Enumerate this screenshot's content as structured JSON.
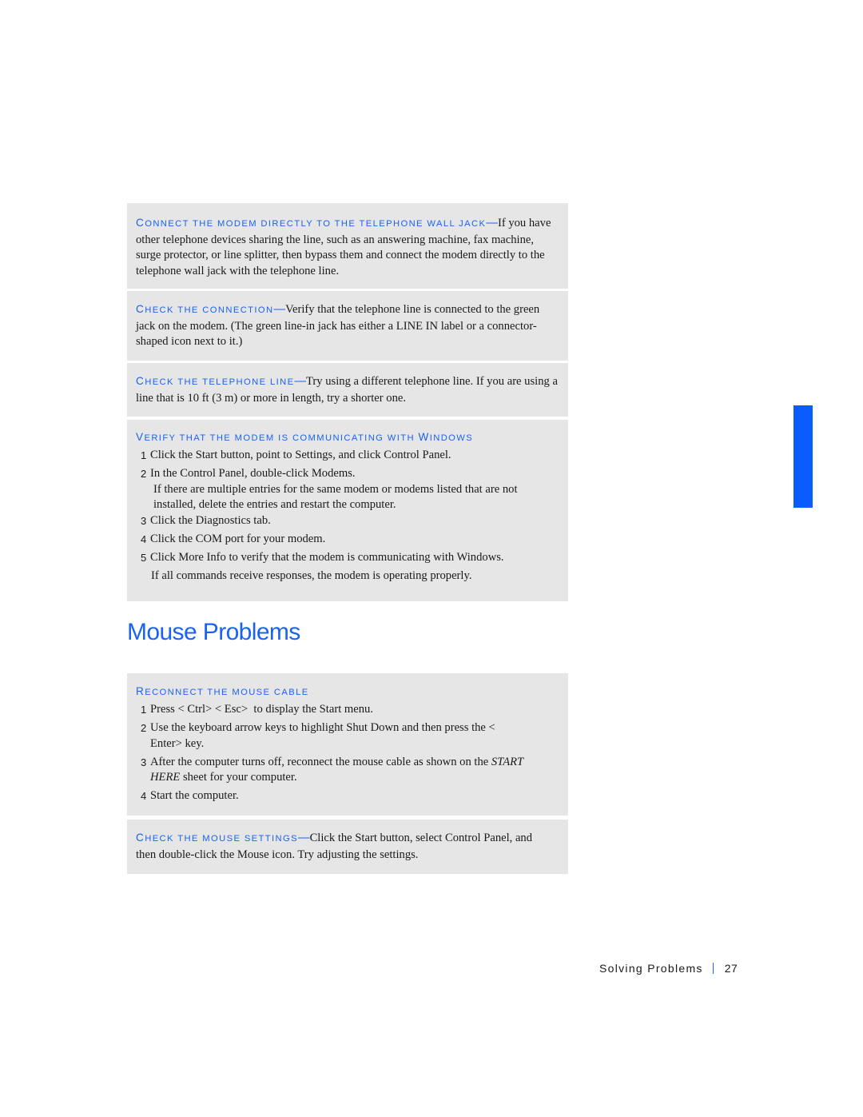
{
  "boxes": {
    "wall_jack": {
      "heading_cap": "C",
      "heading_rest": "onnect the modem directly to the telephone wall jack",
      "dash": "—",
      "body": "If you have other telephone devices sharing the line, such as an answering machine, fax machine, surge protector, or line splitter, then bypass them and connect the modem directly to the telephone wall jack with the telephone line."
    },
    "connection": {
      "heading_cap": "C",
      "heading_rest": "heck the connection",
      "dash": "—",
      "body": "Verify that the telephone line is connected to the green jack on the modem. (The green line-in jack has either a LINE IN label or a connector-shaped icon next to it.)"
    },
    "telephone_line": {
      "heading_cap": "C",
      "heading_rest": "heck the telephone line",
      "dash": "—",
      "body": "Try using a different telephone line. If you are using a line that is 10 ft (3 m) or more in length, try a shorter one."
    },
    "verify_modem": {
      "heading_cap": "V",
      "heading_rest": "erify that the modem is communicating with ",
      "heading_cap2": "W",
      "heading_rest2": "indows",
      "steps": [
        {
          "num": "1",
          "text": "Click the Start button, point to Settings, and click Control Panel."
        },
        {
          "num": "2",
          "text": "In the Control Panel, double-click Modems."
        },
        {
          "num": "3",
          "text": "Click the Diagnostics tab."
        },
        {
          "num": "4",
          "text": "Click the COM port for your modem."
        },
        {
          "num": "5",
          "text": "Click More Info to verify that the modem is communicating with Windows."
        }
      ],
      "step2_note": "If there are multiple entries for the same modem or modems listed that are not installed, delete the entries and restart the computer.",
      "followup": "If all commands receive responses, the modem is operating properly."
    },
    "reconnect_mouse": {
      "heading_cap": "R",
      "heading_rest": "econnect the mouse cable",
      "steps": [
        {
          "num": "1",
          "text": "Press < Ctrl> < Esc>  to display the Start menu."
        },
        {
          "num": "2",
          "text": "Use the keyboard arrow keys to highlight Shut Down and then press the < Enter>  key."
        },
        {
          "num": "3",
          "text_italic": "START HERE",
          "text_pre": "After the computer turns off, reconnect the mouse cable as shown on the ",
          "text_post": " sheet for your computer."
        },
        {
          "num": "4",
          "text": "Start the computer."
        }
      ]
    },
    "mouse_settings": {
      "heading_cap": "C",
      "heading_rest": "heck the mouse settings",
      "dash": "—",
      "body": "Click the Start button, select Control Panel, and then double-click the Mouse icon. Try adjusting the settings."
    }
  },
  "section_title": "Mouse Problems",
  "footer": {
    "chapter": "Solving Problems",
    "page_number": "27"
  },
  "colors": {
    "accent": "#1a63f0",
    "box_bg": "#e6e6e6",
    "thumb_tab": "#0a5cff"
  }
}
